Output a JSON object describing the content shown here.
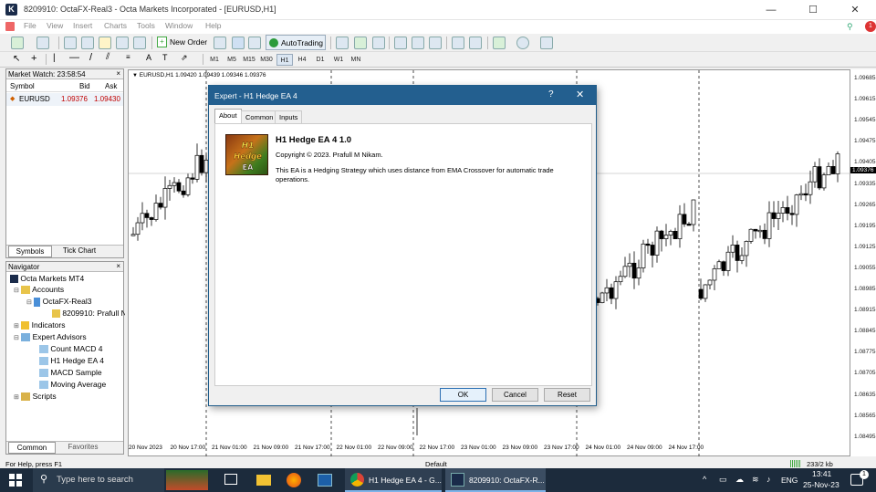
{
  "window": {
    "title": "8209910: OctaFX-Real3 - Octa Markets Incorporated - [EURUSD,H1]",
    "min": "—",
    "max": "☐",
    "close": "✕"
  },
  "menu": [
    "File",
    "View",
    "Insert",
    "Charts",
    "Tools",
    "Window",
    "Help"
  ],
  "toolbar": {
    "new_order": "New Order",
    "autotrading": "AutoTrading"
  },
  "timeframes": [
    "M1",
    "M5",
    "M15",
    "M30",
    "H1",
    "H4",
    "D1",
    "W1",
    "MN"
  ],
  "market_watch": {
    "title": "Market Watch: 23:58:54",
    "columns": [
      "Symbol",
      "Bid",
      "Ask"
    ],
    "rows": [
      {
        "symbol": "EURUSD",
        "bid": "1.09376",
        "ask": "1.09430"
      }
    ],
    "tabs": [
      "Symbols",
      "Tick Chart"
    ]
  },
  "navigator": {
    "title": "Navigator",
    "items": [
      {
        "label": "Octa Markets MT4",
        "level": 0
      },
      {
        "label": "Accounts",
        "level": 1
      },
      {
        "label": "OctaFX-Real3",
        "level": 2
      },
      {
        "label": "8209910: Prafull N",
        "level": 3
      },
      {
        "label": "Indicators",
        "level": 1
      },
      {
        "label": "Expert Advisors",
        "level": 1
      },
      {
        "label": "Count MACD 4",
        "level": 2
      },
      {
        "label": "H1 Hedge EA 4",
        "level": 2
      },
      {
        "label": "MACD Sample",
        "level": 2
      },
      {
        "label": "Moving Average",
        "level": 2
      },
      {
        "label": "Scripts",
        "level": 1
      }
    ],
    "tabs": [
      "Common",
      "Favorites"
    ]
  },
  "chart": {
    "header": "EURUSD,H1  1.09420 1.09439 1.09346 1.09376",
    "current_price": "1.09376",
    "y_labels": [
      "1.09685",
      "1.09615",
      "1.09545",
      "1.09475",
      "1.09405",
      "1.09335",
      "1.09265",
      "1.09195",
      "1.09125",
      "1.09055",
      "1.08985",
      "1.08915",
      "1.08845",
      "1.08775",
      "1.08705",
      "1.08635",
      "1.08565",
      "1.08495"
    ],
    "x_labels": [
      "20 Nov 2023",
      "20 Nov 17:00",
      "21 Nov 01:00",
      "21 Nov 09:00",
      "21 Nov 17:00",
      "22 Nov 01:00",
      "22 Nov 09:00",
      "22 Nov 17:00",
      "23 Nov 01:00",
      "23 Nov 09:00",
      "23 Nov 17:00",
      "24 Nov 01:00",
      "24 Nov 09:00",
      "24 Nov 17:00"
    ]
  },
  "dialog": {
    "title": "Expert - H1 Hedge EA 4",
    "help": "?",
    "close": "✕",
    "tabs": [
      "About",
      "Common",
      "Inputs"
    ],
    "ea_name": "H1 Hedge EA 4 1.0",
    "copyright": "Copyright © 2023. Prafull M Nikam.",
    "description": "This EA is a Hedging Strategy which uses distance from EMA Crossover for automatic trade operations.",
    "logo_text": "H1 Hedge EA 4",
    "buttons": {
      "ok": "OK",
      "cancel": "Cancel",
      "reset": "Reset"
    }
  },
  "status": {
    "help": "For Help, press F1",
    "profile": "Default",
    "traffic": "233/2 kb"
  },
  "taskbar": {
    "search": "Type here to search",
    "apps": [
      "H1 Hedge EA 4 - G...",
      "8209910: OctaFX-R..."
    ],
    "lang": "ENG",
    "time": "13:41",
    "date": "25-Nov-23",
    "notif_count": "1"
  },
  "colors": {
    "dialog_title": "#235f8f",
    "bid": "#c00000",
    "taskbar": "#1c2b3c"
  }
}
